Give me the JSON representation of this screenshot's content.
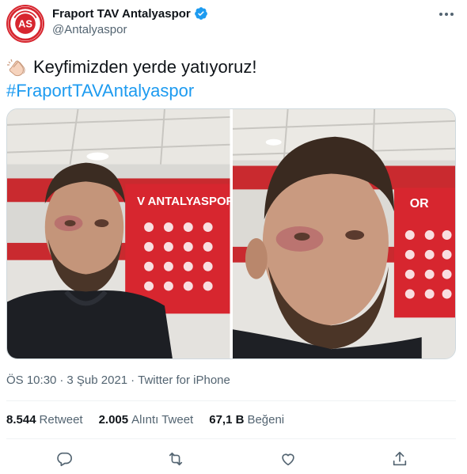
{
  "author": {
    "display_name": "Fraport TAV Antalyaspor",
    "handle": "@Antalyaspor",
    "avatar_logo_text": "ANTALYASPOR"
  },
  "tweet": {
    "text": "Keyfimizden yerde yatıyoruz!",
    "hashtag": "#FraportTAVAntalyaspor",
    "leading_emoji": "clapping-hands"
  },
  "media": {
    "board_text_left": "V ANTALYASPOR",
    "board_text_right": "OR"
  },
  "meta": {
    "time": "ÖS 10:30",
    "separator": "·",
    "date": "3 Şub 2021",
    "source": "Twitter for iPhone"
  },
  "stats": {
    "retweets": {
      "value": "8.544",
      "label": "Retweet"
    },
    "quotes": {
      "value": "2.005",
      "label": "Alıntı Tweet"
    },
    "likes": {
      "value": "67,1 B",
      "label": "Beğeni"
    }
  },
  "colors": {
    "brand_red": "#d7262f",
    "link_blue": "#1d9bf0",
    "verified_blue": "#1d9bf0",
    "secondary_text": "#536471"
  }
}
